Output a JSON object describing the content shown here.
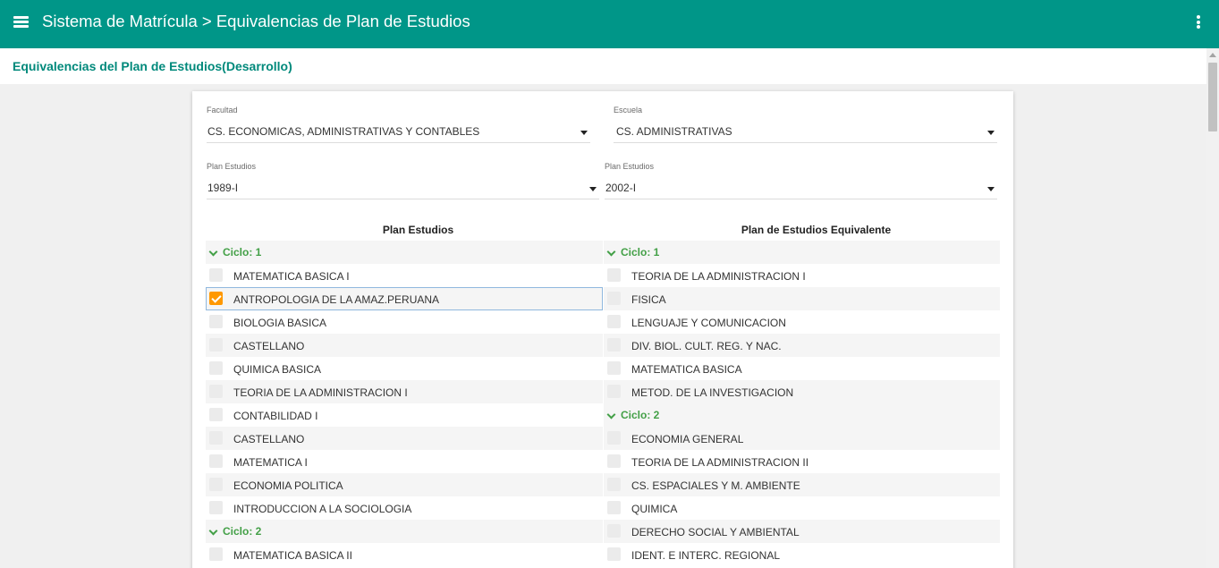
{
  "app": {
    "title": "Sistema de Matrícula > Equivalencias de Plan de Estudios"
  },
  "page": {
    "title": "Equivalencias del Plan de Estudios(Desarrollo)"
  },
  "filters": {
    "facultad": {
      "label": "Facultad",
      "value": "CS. ECONOMICAS, ADMINISTRATIVAS Y CONTABLES"
    },
    "escuela": {
      "label": "Escuela",
      "value": "CS. ADMINISTRATIVAS"
    },
    "plan_left": {
      "label": "Plan Estudios",
      "value": "1989-I"
    },
    "plan_right": {
      "label": "Plan Estudios",
      "value": "2002-I"
    }
  },
  "left": {
    "header": "Plan Estudios",
    "rows": [
      {
        "type": "cycle",
        "label": "Ciclo: 1"
      },
      {
        "type": "course",
        "label": "MATEMATICA BASICA I",
        "checked": false
      },
      {
        "type": "course",
        "label": "ANTROPOLOGIA DE LA AMAZ.PERUANA",
        "checked": true
      },
      {
        "type": "course",
        "label": "BIOLOGIA BASICA",
        "checked": false
      },
      {
        "type": "course",
        "label": "CASTELLANO",
        "checked": false
      },
      {
        "type": "course",
        "label": "QUIMICA BASICA",
        "checked": false
      },
      {
        "type": "course",
        "label": "TEORIA DE LA ADMINISTRACION I",
        "checked": false
      },
      {
        "type": "course",
        "label": "CONTABILIDAD I",
        "checked": false
      },
      {
        "type": "course",
        "label": "CASTELLANO",
        "checked": false
      },
      {
        "type": "course",
        "label": "MATEMATICA I",
        "checked": false
      },
      {
        "type": "course",
        "label": "ECONOMIA POLITICA",
        "checked": false
      },
      {
        "type": "course",
        "label": "INTRODUCCION A LA SOCIOLOGIA",
        "checked": false
      },
      {
        "type": "cycle",
        "label": "Ciclo: 2"
      },
      {
        "type": "course",
        "label": "MATEMATICA BASICA II",
        "checked": false
      }
    ]
  },
  "right": {
    "header": "Plan de Estudios Equivalente",
    "rows": [
      {
        "type": "cycle",
        "label": "Ciclo: 1"
      },
      {
        "type": "course",
        "label": "TEORIA DE LA ADMINISTRACION I",
        "checked": false
      },
      {
        "type": "course",
        "label": "FISICA",
        "checked": false
      },
      {
        "type": "course",
        "label": "LENGUAJE Y COMUNICACION",
        "checked": false
      },
      {
        "type": "course",
        "label": "DIV. BIOL. CULT. REG. Y NAC.",
        "checked": false
      },
      {
        "type": "course",
        "label": "MATEMATICA BASICA",
        "checked": false
      },
      {
        "type": "course",
        "label": "METOD. DE LA INVESTIGACION",
        "checked": false
      },
      {
        "type": "cycle",
        "label": "Ciclo: 2"
      },
      {
        "type": "course",
        "label": "ECONOMIA GENERAL",
        "checked": false
      },
      {
        "type": "course",
        "label": "TEORIA DE LA ADMINISTRACION II",
        "checked": false
      },
      {
        "type": "course",
        "label": "CS. ESPACIALES Y M. AMBIENTE",
        "checked": false
      },
      {
        "type": "course",
        "label": "QUIMICA",
        "checked": false
      },
      {
        "type": "course",
        "label": "DERECHO SOCIAL Y AMBIENTAL",
        "checked": false
      },
      {
        "type": "course",
        "label": "IDENT. E INTERC. REGIONAL",
        "checked": false
      }
    ]
  },
  "icons": {
    "menu": "hamburger-icon",
    "more": "more-vertical-icon",
    "expand": "chevron-down-icon"
  },
  "colors": {
    "primary": "#009688",
    "title": "#00897b",
    "cycle": "#43a047",
    "checked": "#ff9800"
  }
}
